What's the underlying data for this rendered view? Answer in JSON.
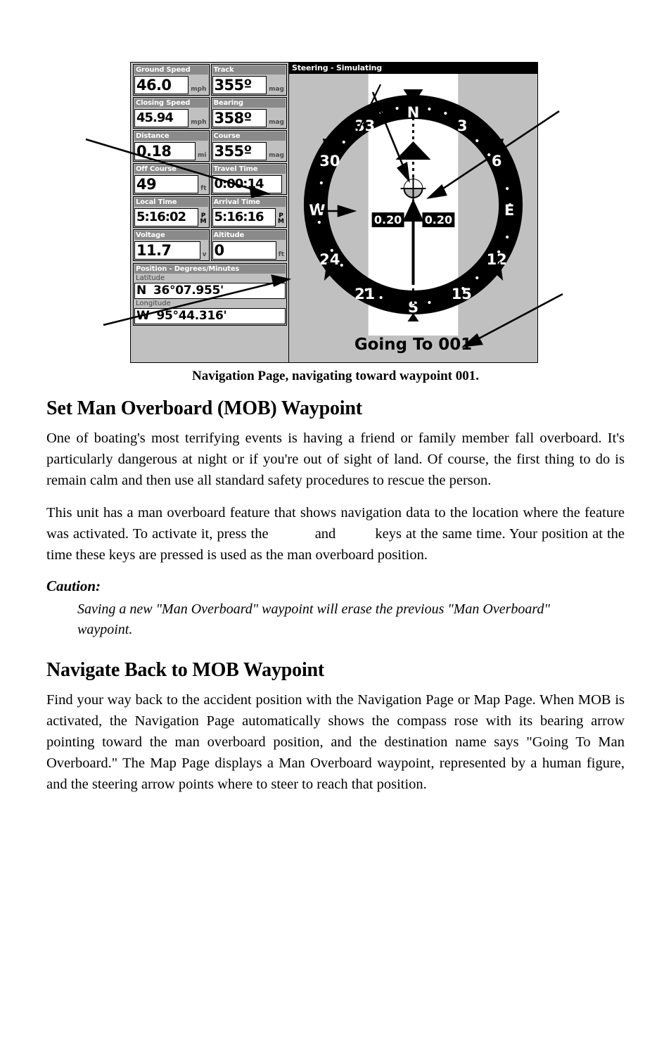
{
  "figure": {
    "caption": "Navigation Page, navigating toward waypoint 001.",
    "device": {
      "data_fields": [
        [
          {
            "label": "Ground Speed",
            "value": "46.0",
            "unit": "mph"
          },
          {
            "label": "Track",
            "value": "355º",
            "unit": "mag"
          }
        ],
        [
          {
            "label": "Closing Speed",
            "value": "45.94",
            "unit": "mph"
          },
          {
            "label": "Bearing",
            "value": "358º",
            "unit": "mag"
          }
        ],
        [
          {
            "label": "Distance",
            "value": "0.18",
            "unit": "mi"
          },
          {
            "label": "Course",
            "value": "355º",
            "unit": "mag"
          }
        ],
        [
          {
            "label": "Off Course",
            "value": "49",
            "unit": "ft"
          },
          {
            "label": "Travel Time",
            "value": "0:00:14",
            "unit": ""
          }
        ],
        [
          {
            "label": "Local Time",
            "value": "5:16:02",
            "unit": "PM"
          },
          {
            "label": "Arrival Time",
            "value": "5:16:16",
            "unit": "PM"
          }
        ],
        [
          {
            "label": "Voltage",
            "value": "11.7",
            "unit": "v"
          },
          {
            "label": "Altitude",
            "value": "0",
            "unit": "ft"
          }
        ]
      ],
      "position": {
        "title": "Position - Degrees/Minutes",
        "latitude_label": "Latitude",
        "latitude_hemisphere": "N",
        "latitude_value": "36°07.955'",
        "longitude_label": "Longitude",
        "longitude_hemisphere": "W",
        "longitude_value": "95°44.316'"
      },
      "compass": {
        "titlebar": "Steering - Simulating",
        "destination": "Going To 001",
        "cross_track_left": "0.20",
        "cross_track_right": "0.20",
        "ring_labels": [
          "N",
          "3",
          "6",
          "E",
          "12",
          "15",
          "S",
          "21",
          "24",
          "W",
          "30",
          "33"
        ],
        "colors": {
          "panel_background": "#c0c0c0",
          "ring": "#000000",
          "corridor": "#ffffff",
          "titlebar": "#000000",
          "titlebar_text": "#ffffff"
        }
      }
    }
  },
  "content": {
    "heading_1": "Set Man Overboard (MOB) Waypoint",
    "paragraph_1": "One of boating's most terrifying events is having a friend or family member fall overboard. It's particularly dangerous at night or if you're out of sight of land. Of course, the first thing to do is remain calm and then use all standard safety procedures to rescue the person.",
    "paragraph_2_part_1": "This unit has a man overboard feature that shows navigation data to the location where the feature was activated. To activate it, press the",
    "paragraph_2_part_2": "and",
    "paragraph_2_part_3": "keys at the same time. Your position at the time these keys are pressed is used as the man overboard position.",
    "caution_heading": "Caution:",
    "caution_body": "Saving a new \"Man Overboard\" waypoint will erase the previous \"Man Overboard\" waypoint.",
    "heading_2": "Navigate Back to MOB Waypoint",
    "paragraph_3": "Find your way back to the accident position with the Navigation Page or Map Page. When MOB is activated, the Navigation Page automatically shows the compass rose with its bearing arrow pointing toward the man overboard position, and the destination name says \"Going To Man Overboard.\" The Map Page displays a Man Overboard waypoint, represented by a human figure, and the steering arrow points where to steer to reach that position."
  }
}
